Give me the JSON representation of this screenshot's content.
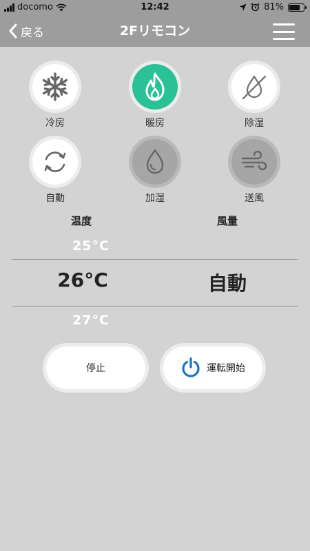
{
  "status_bar": {
    "carrier": "docomo",
    "time": "12:42",
    "battery_percent": 81,
    "battery_label": "81%"
  },
  "nav": {
    "back_label": "戻る",
    "title": "2Fリモコン"
  },
  "modes": [
    {
      "label": "冷房",
      "icon": "snowflake-icon",
      "state": "normal"
    },
    {
      "label": "暖房",
      "icon": "flame-icon",
      "state": "selected"
    },
    {
      "label": "除湿",
      "icon": "no-drop-icon",
      "state": "normal"
    },
    {
      "label": "自動",
      "icon": "refresh-icon",
      "state": "normal"
    },
    {
      "label": "加湿",
      "icon": "drop-icon",
      "state": "disabled"
    },
    {
      "label": "送風",
      "icon": "wind-icon",
      "state": "disabled"
    }
  ],
  "temperature": {
    "label": "温度",
    "prev": "25°C",
    "current": "26°C",
    "next": "27°C"
  },
  "fan": {
    "label": "風量",
    "current": "自動"
  },
  "controls": {
    "stop_label": "停止",
    "start_label": "運転開始"
  },
  "colors": {
    "accent_green": "#2bc196",
    "power_blue": "#1a73c8",
    "nav_gray": "#9d9d9d",
    "background": "#d3d3d3"
  }
}
